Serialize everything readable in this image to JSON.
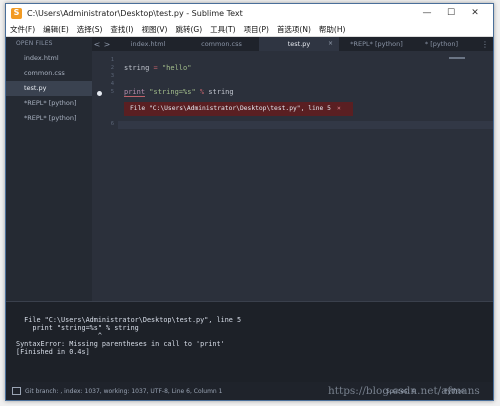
{
  "window": {
    "title": "C:\\Users\\Administrator\\Desktop\\test.py - Sublime Text",
    "minimize": "—",
    "maximize": "☐",
    "close": "✕"
  },
  "menu": [
    "文件(F)",
    "编辑(E)",
    "选择(S)",
    "查找(I)",
    "视图(V)",
    "跳转(G)",
    "工具(T)",
    "项目(P)",
    "首选项(N)",
    "帮助(H)"
  ],
  "sidebar": {
    "header": "OPEN FILES",
    "files": [
      "index.html",
      "common.css",
      "test.py",
      "*REPL* [python]",
      "*REPL* [python]"
    ],
    "active_index": 2
  },
  "tabs": {
    "items": [
      "index.html",
      "common.css",
      "test.py",
      "*REPL* [python]",
      "* [python]"
    ],
    "active_index": 2,
    "close_glyph": "×",
    "nav_prev": "<",
    "nav_next": ">",
    "overflow": "⋮"
  },
  "editor": {
    "line_numbers": [
      "1",
      "2",
      "3",
      "4",
      "5",
      "",
      "6"
    ],
    "line2": {
      "var": "string",
      "op": " = ",
      "value": "\"hello\""
    },
    "line5": {
      "kw": "print",
      "space": " ",
      "str": "\"string=%s\"",
      "op": " % ",
      "var": "string"
    },
    "error_text": "File \"C:\\Users\\Administrator\\Desktop\\test.py\", line 5",
    "error_close": "×"
  },
  "output": {
    "lines": [
      "  File \"C:\\Users\\Administrator\\Desktop\\test.py\", line 5",
      "    print \"string=%s\" % string",
      "                    ^",
      "SyntaxError: Missing parentheses in call to 'print'",
      "[Finished in 0.4s]"
    ]
  },
  "status": {
    "left": "Git branch: , index: 1037, working: 1037, UTF-8, Line 6, Column 1",
    "spaces": "Spaces: 4",
    "syntax": "Python"
  },
  "watermark": "https://blog.csdn.net/afmans"
}
